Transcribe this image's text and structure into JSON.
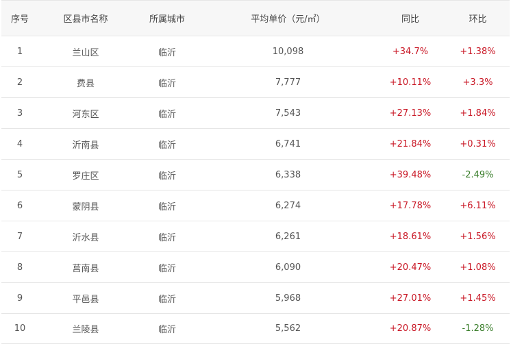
{
  "table": {
    "headers": {
      "index": "序号",
      "district": "区县市名称",
      "city": "所属城市",
      "price": "平均单价（元/㎡）",
      "yoy": "同比",
      "mom": "环比"
    },
    "rows": [
      {
        "index": "1",
        "district": "兰山区",
        "city": "临沂",
        "price": "10,098",
        "yoy": "+34.7%",
        "mom": "+1.38%"
      },
      {
        "index": "2",
        "district": "费县",
        "city": "临沂",
        "price": "7,777",
        "yoy": "+10.11%",
        "mom": "+3.3%"
      },
      {
        "index": "3",
        "district": "河东区",
        "city": "临沂",
        "price": "7,543",
        "yoy": "+27.13%",
        "mom": "+1.84%"
      },
      {
        "index": "4",
        "district": "沂南县",
        "city": "临沂",
        "price": "6,741",
        "yoy": "+21.84%",
        "mom": "+0.31%"
      },
      {
        "index": "5",
        "district": "罗庄区",
        "city": "临沂",
        "price": "6,338",
        "yoy": "+39.48%",
        "mom": "-2.49%"
      },
      {
        "index": "6",
        "district": "蒙阴县",
        "city": "临沂",
        "price": "6,274",
        "yoy": "+17.78%",
        "mom": "+6.11%"
      },
      {
        "index": "7",
        "district": "沂水县",
        "city": "临沂",
        "price": "6,261",
        "yoy": "+18.61%",
        "mom": "+1.56%"
      },
      {
        "index": "8",
        "district": "莒南县",
        "city": "临沂",
        "price": "6,090",
        "yoy": "+20.47%",
        "mom": "+1.08%"
      },
      {
        "index": "9",
        "district": "平邑县",
        "city": "临沂",
        "price": "5,968",
        "yoy": "+27.01%",
        "mom": "+1.45%"
      },
      {
        "index": "10",
        "district": "兰陵县",
        "city": "临沂",
        "price": "5,562",
        "yoy": "+20.87%",
        "mom": "-1.28%"
      }
    ]
  },
  "colors": {
    "increase": "#c91725",
    "decrease": "#3a7e2b",
    "header_bg": "#f7f7f7",
    "border": "#e6e6e6"
  }
}
